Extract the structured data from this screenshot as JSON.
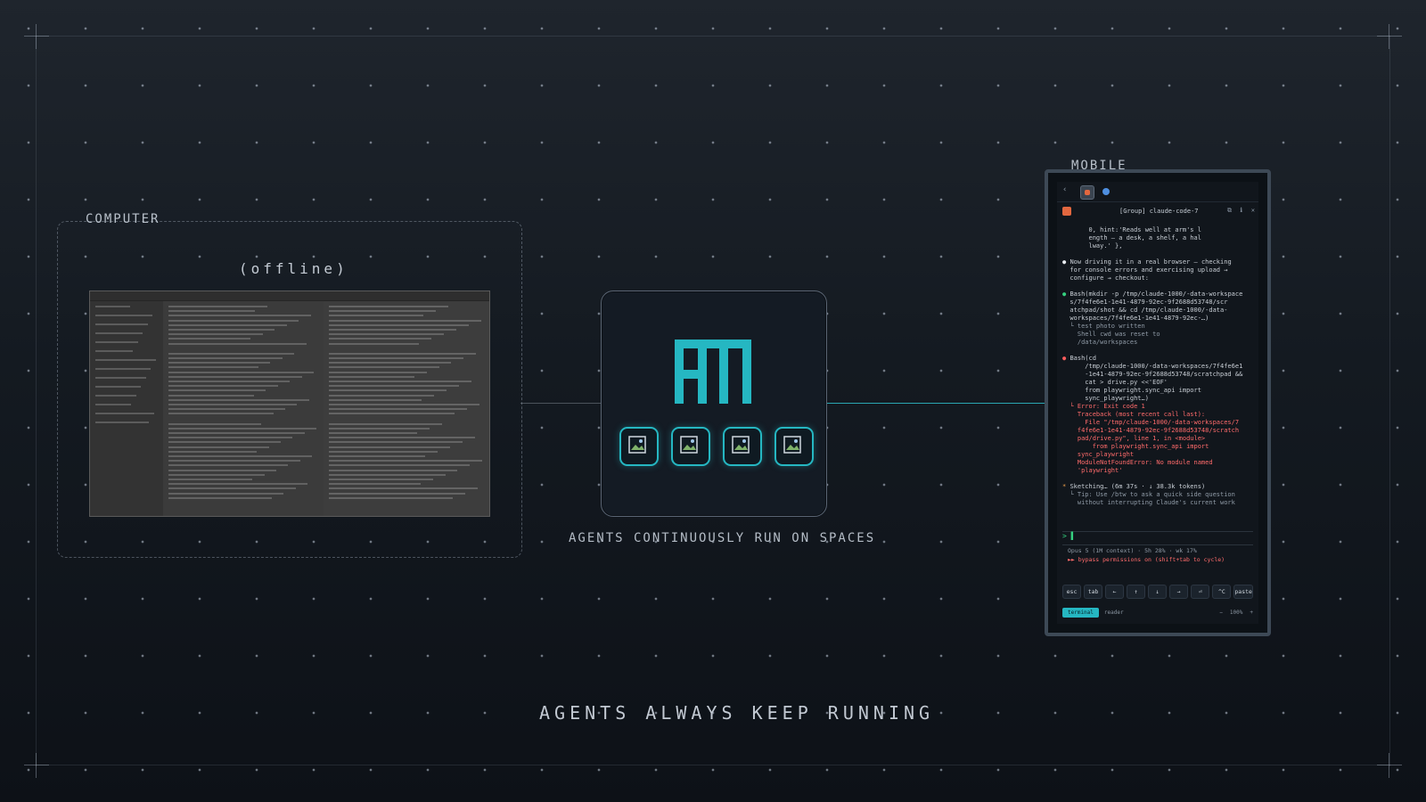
{
  "computer": {
    "label": "COMPUTER",
    "status": "(offline)"
  },
  "hub": {
    "caption": "AGENTS CONTINUOUSLY RUN ON SPACES"
  },
  "mobile": {
    "label": "MOBILE",
    "session_title": "[Group] claude-code-7",
    "terminal_lines": [
      {
        "cls": "",
        "text": "       0, hint:'Reads well at arm's l"
      },
      {
        "cls": "",
        "text": "       ength — a desk, a shelf, a hal"
      },
      {
        "cls": "",
        "text": "       lway.' },"
      },
      {
        "cls": "",
        "text": " "
      },
      {
        "cls": "bullet-w",
        "text": "Now driving it in a real browser — checking"
      },
      {
        "cls": "",
        "text": "  for console errors and exercising upload →"
      },
      {
        "cls": "",
        "text": "  configure → checkout:"
      },
      {
        "cls": "",
        "text": " "
      },
      {
        "cls": "bullet-g",
        "text": "Bash(mkdir -p /tmp/claude-1000/-data-workspace"
      },
      {
        "cls": "",
        "text": "  s/7f4fe6e1-1e41-4879-92ec-9f2688d53748/scr"
      },
      {
        "cls": "",
        "text": "  atchpad/shot && cd /tmp/claude-1000/-data-"
      },
      {
        "cls": "",
        "text": "  workspaces/7f4fe6e1-1e41-4879-92ec-…)"
      },
      {
        "cls": "grey",
        "text": "  └ test photo written"
      },
      {
        "cls": "grey",
        "text": "    Shell cwd was reset to"
      },
      {
        "cls": "grey",
        "text": "    /data/workspaces"
      },
      {
        "cls": "",
        "text": " "
      },
      {
        "cls": "bullet-r",
        "text": "Bash(cd"
      },
      {
        "cls": "",
        "text": "      /tmp/claude-1000/-data-workspaces/7f4fe6e1"
      },
      {
        "cls": "",
        "text": "      -1e41-4879-92ec-9f2688d53748/scratchpad &&"
      },
      {
        "cls": "",
        "text": "      cat > drive.py <<'EOF'"
      },
      {
        "cls": "",
        "text": "      from playwright.sync_api import"
      },
      {
        "cls": "",
        "text": "      sync_playwright…)"
      },
      {
        "cls": "err",
        "text": "  └ Error: Exit code 1"
      },
      {
        "cls": "err",
        "text": "    Traceback (most recent call last):"
      },
      {
        "cls": "err",
        "text": "      File \"/tmp/claude-1000/-data-workspaces/7"
      },
      {
        "cls": "err",
        "text": "    f4fe6e1-1e41-4879-92ec-9f2688d53748/scratch"
      },
      {
        "cls": "err",
        "text": "    pad/drive.py\", line 1, in <module>"
      },
      {
        "cls": "err",
        "text": "        from playwright.sync_api import"
      },
      {
        "cls": "err",
        "text": "    sync_playwright"
      },
      {
        "cls": "err",
        "text": "    ModuleNotFoundError: No module named"
      },
      {
        "cls": "err",
        "text": "    'playwright'"
      },
      {
        "cls": "",
        "text": " "
      },
      {
        "cls": "bullet-o",
        "text": "Sketching… (6m 37s · ↓ 38.3k tokens)"
      },
      {
        "cls": "grey",
        "text": "  └ Tip: Use /btw to ask a quick side question"
      },
      {
        "cls": "grey",
        "text": "    without interrupting Claude's current work"
      }
    ],
    "prompt": "> ▌",
    "status_line": "Opus 5 (1M context) · 5h 28% · wk 17%",
    "bypass_line": "►► bypass permissions on (shift+tab to cycle)",
    "keys": [
      "esc",
      "tab",
      "←",
      "↑",
      "↓",
      "→",
      "⏎",
      "^C",
      "paste"
    ],
    "tab_terminal": "terminal",
    "tab_reader": "reader",
    "zoom_minus": "−",
    "zoom": "100%",
    "zoom_plus": "+"
  },
  "bottom": {
    "caption": "AGENTS ALWAYS KEEP RUNNING"
  },
  "colors": {
    "accent": "#25b7c2",
    "error": "#ff6b6b",
    "success": "#35d07f"
  }
}
